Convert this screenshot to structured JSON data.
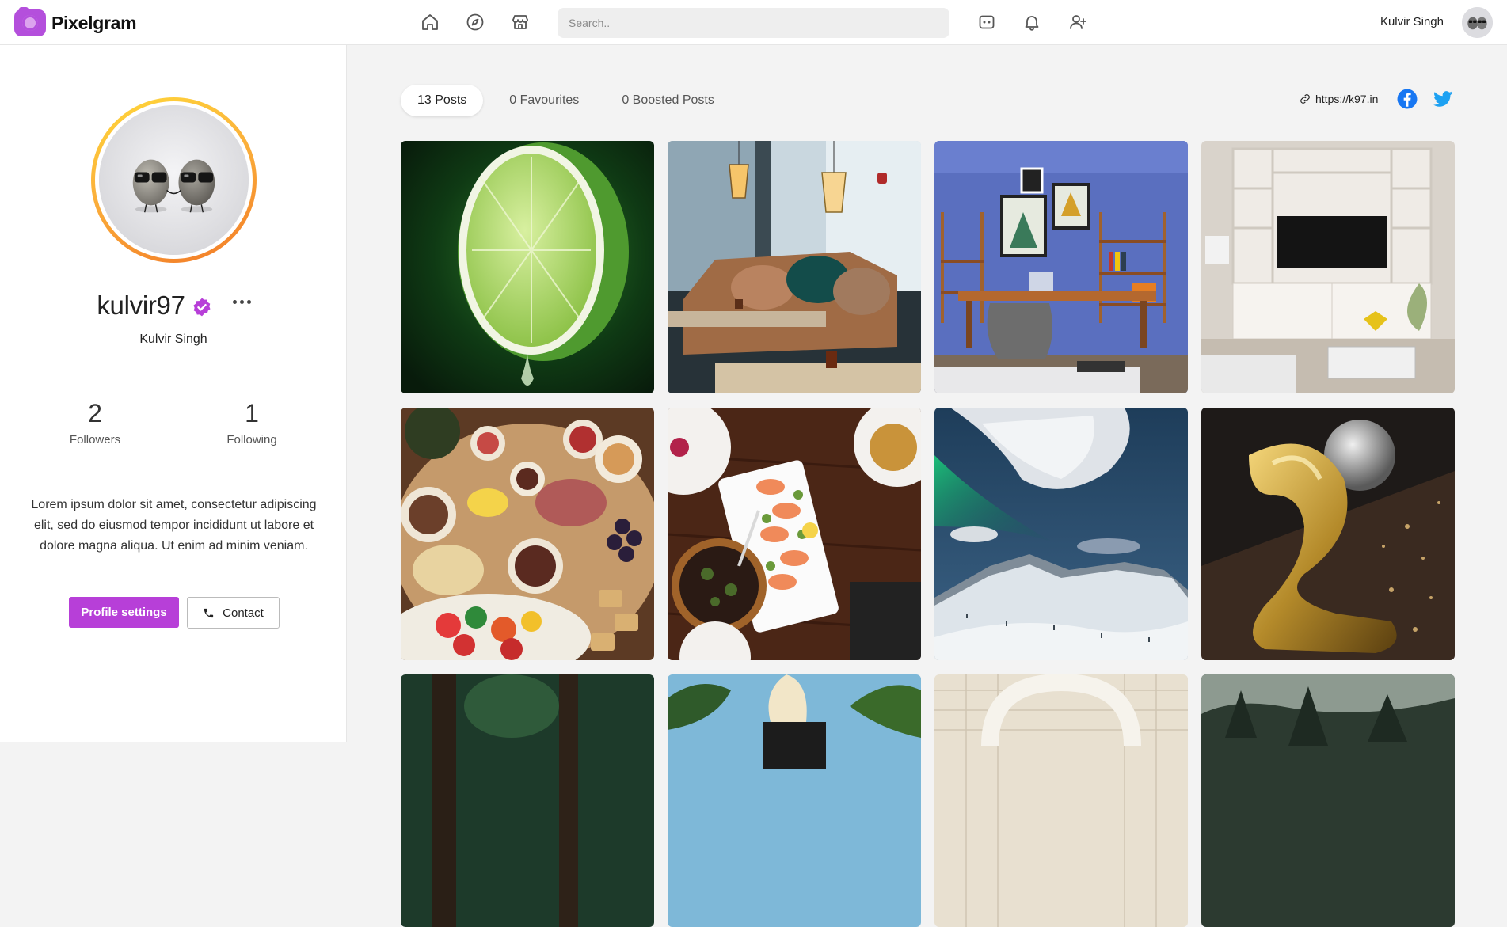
{
  "brand": {
    "name": "Pixelgram",
    "logo_icon": "camera-icon",
    "accent": "#b73fd8"
  },
  "nav": {
    "icons": [
      "home-icon",
      "compass-icon",
      "store-icon",
      "messages-icon",
      "bell-icon",
      "add-user-icon"
    ],
    "search_placeholder": "Search.."
  },
  "current_user": {
    "name": "Kulvir Singh",
    "avatar_icon": "sunglasses-stones-avatar"
  },
  "profile": {
    "handle": "kulvir97",
    "verified_icon": "verified-badge-icon",
    "full_name": "Kulvir Singh",
    "followers_count": "2",
    "followers_label": "Followers",
    "following_count": "1",
    "following_label": "Following",
    "bio": "Lorem ipsum dolor sit amet, consectetur adipiscing elit, sed do eiusmod tempor incididunt ut labore et dolore magna aliqua. Ut enim ad minim veniam.",
    "settings_button": "Profile settings",
    "contact_button": "Contact",
    "ring_colors": [
      "#ffd83a",
      "#f27a27"
    ]
  },
  "tabs": [
    {
      "label": "13 Posts",
      "active": true
    },
    {
      "label": "0 Favourites",
      "active": false
    },
    {
      "label": "0 Boosted Posts",
      "active": false
    }
  ],
  "links": {
    "website": "https://k97.in",
    "facebook_icon": "facebook-icon",
    "twitter_icon": "twitter-icon",
    "facebook_color": "#1877f2",
    "twitter_color": "#1da1f2"
  },
  "posts": [
    {
      "subject": "lime-half-photo"
    },
    {
      "subject": "cafe-interior-photo"
    },
    {
      "subject": "blue-office-photo"
    },
    {
      "subject": "living-room-tv-photo"
    },
    {
      "subject": "charcuterie-board-photo"
    },
    {
      "subject": "shrimp-dinner-photo"
    },
    {
      "subject": "aurora-mountains-photo"
    },
    {
      "subject": "gold-balloon-photo"
    },
    {
      "subject": "forest-photo"
    },
    {
      "subject": "palm-trees-photo"
    },
    {
      "subject": "tiled-arch-photo"
    },
    {
      "subject": "misty-forest-photo"
    }
  ]
}
